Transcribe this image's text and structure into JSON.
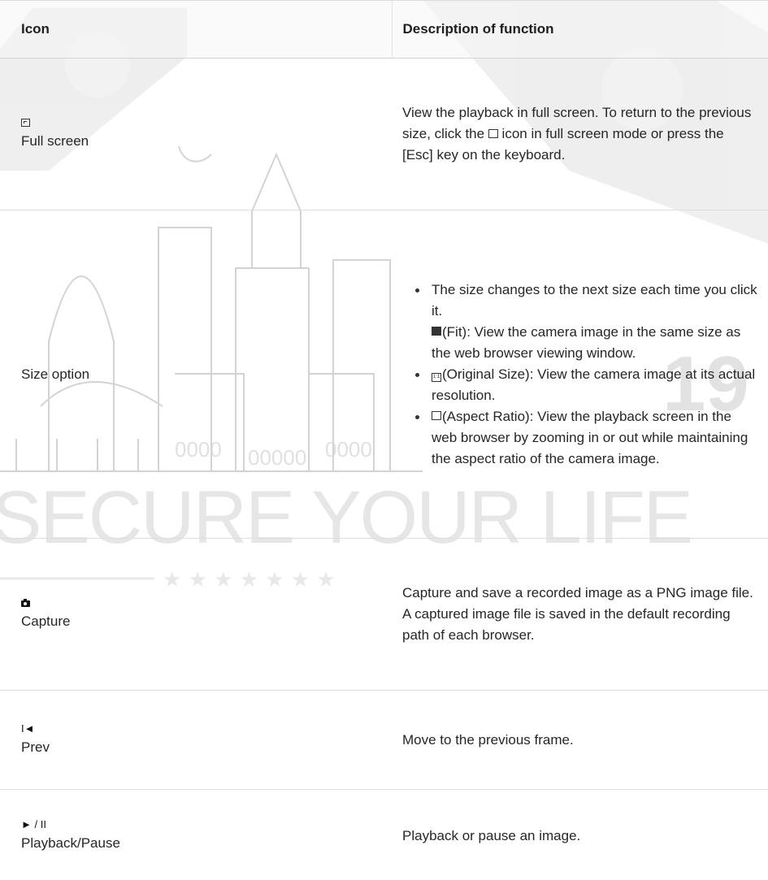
{
  "header": {
    "col1": "Icon",
    "col2": "Description of function"
  },
  "watermark": {
    "slogan": "SECURE YOUR LIFE",
    "number": "19"
  },
  "rows": [
    {
      "icon_name": "full-screen-icon",
      "label": "Full screen",
      "desc_part1": "View the playback in full screen. To return to the previous size, click the ",
      "desc_part2": " icon in full screen mode or press the [Esc] key on the keyboard."
    },
    {
      "icon_name": "size-option",
      "label": "Size option",
      "bullet1_line1": "The size changes to the next size each time you click it.",
      "bullet1_line2": "(Fit): View the camera image in the same size as the web browser viewing window.",
      "bullet2": "(Original Size): View the camera image at its actual resolution.",
      "bullet3": "(Aspect Ratio): View the playback screen in the web browser by zooming in or out while maintaining the aspect ratio of the camera image."
    },
    {
      "icon_name": "camera-icon",
      "label": "Capture",
      "desc": "Capture and save a recorded image as a PNG image file. A captured image file is saved in the default recording path of each browser."
    },
    {
      "icon_name": "prev-frame-icon",
      "symbol": "I◄",
      "label": "Prev",
      "desc": "Move to the previous frame."
    },
    {
      "icon_name": "play-pause-icon",
      "symbol": "► / II",
      "label": "Playback/Pause",
      "desc": "Playback or pause an image."
    }
  ]
}
